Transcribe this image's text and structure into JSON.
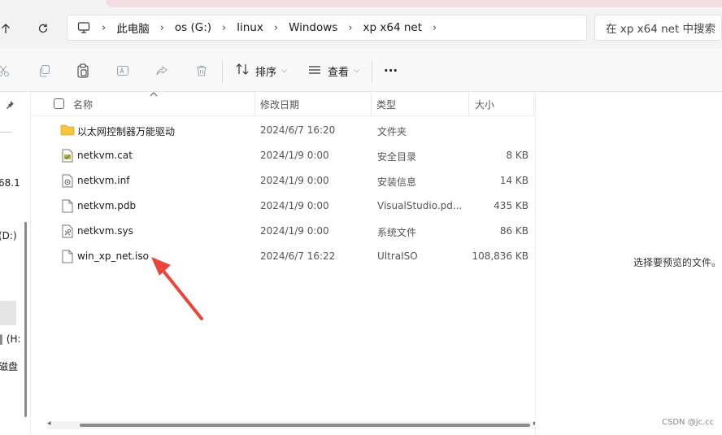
{
  "address_bar": {
    "breadcrumbs": [
      "此电脑",
      "os (G:)",
      "linux",
      "Windows",
      "xp x64 net"
    ],
    "search_placeholder": "在 xp x64 net 中搜索"
  },
  "toolbar": {
    "sort_label": "排序",
    "view_label": "查看",
    "more_label": "···"
  },
  "left_nav": {
    "labels": [
      "68.1",
      "(D:)",
      "‖ (H:",
      "磁盘"
    ]
  },
  "columns": {
    "name": "名称",
    "modified": "修改日期",
    "type": "类型",
    "size": "大小"
  },
  "files": [
    {
      "name": "以太网控制器万能驱动",
      "modified": "2024/6/7 16:20",
      "type": "文件夹",
      "size": "",
      "icon": "folder-icon"
    },
    {
      "name": "netkvm.cat",
      "modified": "2024/1/9 0:00",
      "type": "安全目录",
      "size": "8 KB",
      "icon": "security-catalog-icon"
    },
    {
      "name": "netkvm.inf",
      "modified": "2024/1/9 0:00",
      "type": "安装信息",
      "size": "14 KB",
      "icon": "setup-info-icon"
    },
    {
      "name": "netkvm.pdb",
      "modified": "2024/1/9 0:00",
      "type": "VisualStudio.pd...",
      "size": "435 KB",
      "icon": "file-icon"
    },
    {
      "name": "netkvm.sys",
      "modified": "2024/1/9 0:00",
      "type": "系统文件",
      "size": "86 KB",
      "icon": "system-file-icon"
    },
    {
      "name": "win_xp_net.iso",
      "modified": "2024/6/7 16:22",
      "type": "UltraISO",
      "size": "108,836 KB",
      "icon": "file-icon"
    }
  ],
  "preview": {
    "message": "选择要预览的文件。"
  },
  "watermark": "CSDN @jc.cc",
  "colors": {
    "folder": "#f5c644",
    "arrow": "#e8453c",
    "pink_strip": "#f3dde3"
  }
}
